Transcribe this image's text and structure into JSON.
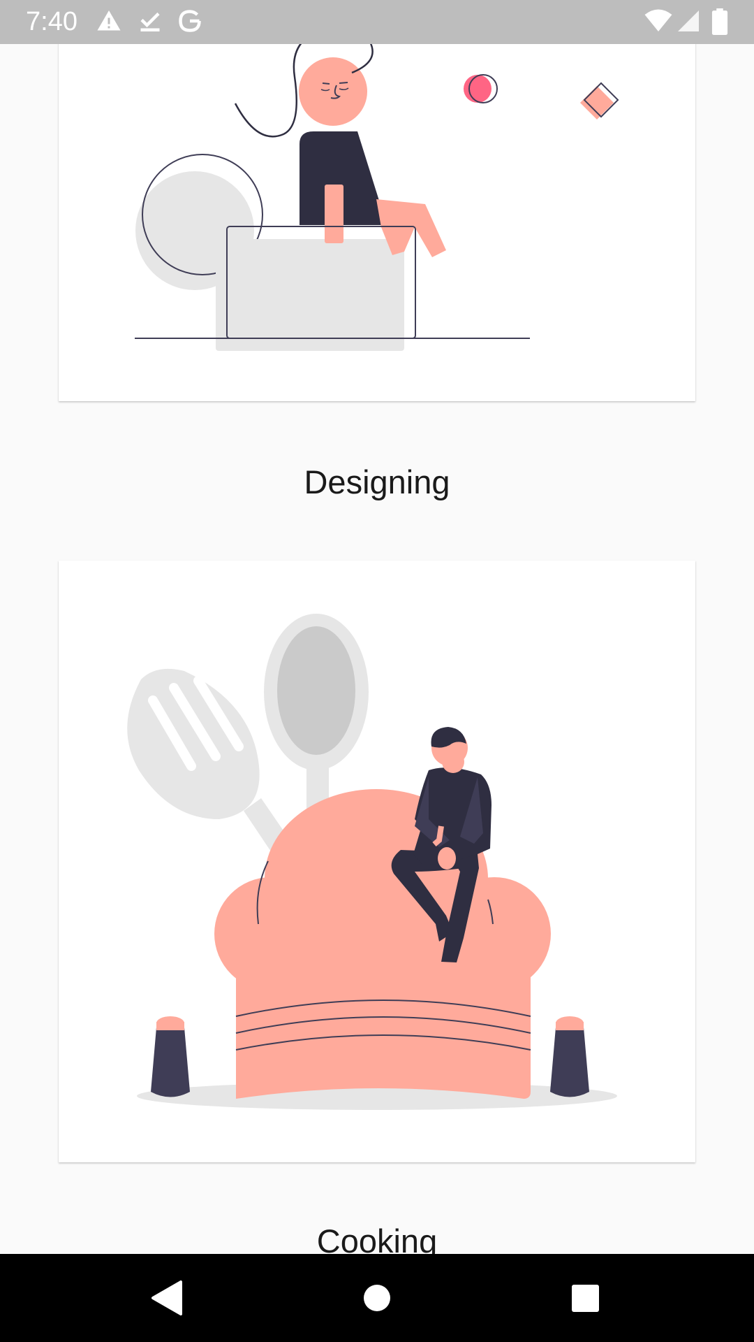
{
  "status_bar": {
    "time": "7:40",
    "left_icons": [
      "warning-icon",
      "check-download-icon",
      "google-icon"
    ],
    "right_icons": [
      "wifi-icon",
      "cell-signal-icon",
      "battery-icon"
    ]
  },
  "cards": [
    {
      "illustration": "person-at-laptop-designing",
      "label": "Designing"
    },
    {
      "illustration": "person-sitting-on-chef-hat-cooking",
      "label": "Cooking"
    }
  ],
  "nav_bar": {
    "buttons": [
      "back-icon",
      "home-icon",
      "recents-icon"
    ]
  },
  "colors": {
    "accent_salmon": "#ffaa9b",
    "dark_figure": "#2f2e41",
    "light_gray": "#e6e6e6",
    "pink": "#ff6584",
    "status_bar": "#bdbdbd",
    "background": "#fafafa"
  }
}
